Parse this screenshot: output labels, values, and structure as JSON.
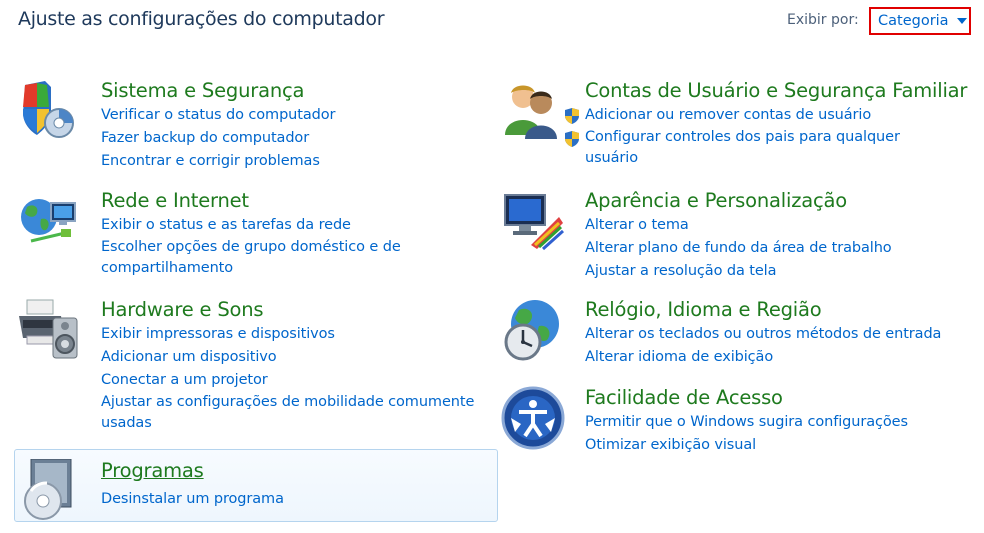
{
  "header": {
    "title": "Ajuste as configurações do computador",
    "view_by_label": "Exibir por:",
    "view_by_value": "Categoria",
    "highlight_color": "#e00000"
  },
  "categories": [
    {
      "title": "Sistema e Segurança",
      "icon": "system-security-icon",
      "links": [
        "Verificar o status do computador",
        "Fazer backup do computador",
        "Encontrar e corrigir problemas"
      ]
    },
    {
      "title": "Rede e Internet",
      "icon": "network-internet-icon",
      "links": [
        "Exibir o status e as tarefas da rede",
        "Escolher opções de grupo doméstico e de compartilhamento"
      ]
    },
    {
      "title": "Hardware e Sons",
      "icon": "hardware-sound-icon",
      "links": [
        "Exibir impressoras e dispositivos",
        "Adicionar um dispositivo",
        "Conectar a um projetor",
        "Ajustar as configurações de mobilidade comumente usadas"
      ]
    },
    {
      "title": "Programas",
      "icon": "programs-icon",
      "links": [
        "Desinstalar um programa"
      ]
    },
    {
      "title": "Contas de Usuário e Segurança Familiar",
      "icon": "user-accounts-icon",
      "links": [
        "Adicionar ou remover contas de usuário",
        "Configurar controles dos pais para qualquer usuário"
      ]
    },
    {
      "title": "Aparência e Personalização",
      "icon": "appearance-icon",
      "links": [
        "Alterar o tema",
        "Alterar plano de fundo da área de trabalho",
        "Ajustar a resolução da tela"
      ]
    },
    {
      "title": "Relógio, Idioma e Região",
      "icon": "clock-region-icon",
      "links": [
        "Alterar os teclados ou outros métodos de entrada",
        "Alterar idioma de exibição"
      ]
    },
    {
      "title": "Facilidade de Acesso",
      "icon": "ease-of-access-icon",
      "links": [
        "Permitir que o Windows sugira configurações",
        "Otimizar exibição visual"
      ]
    }
  ]
}
